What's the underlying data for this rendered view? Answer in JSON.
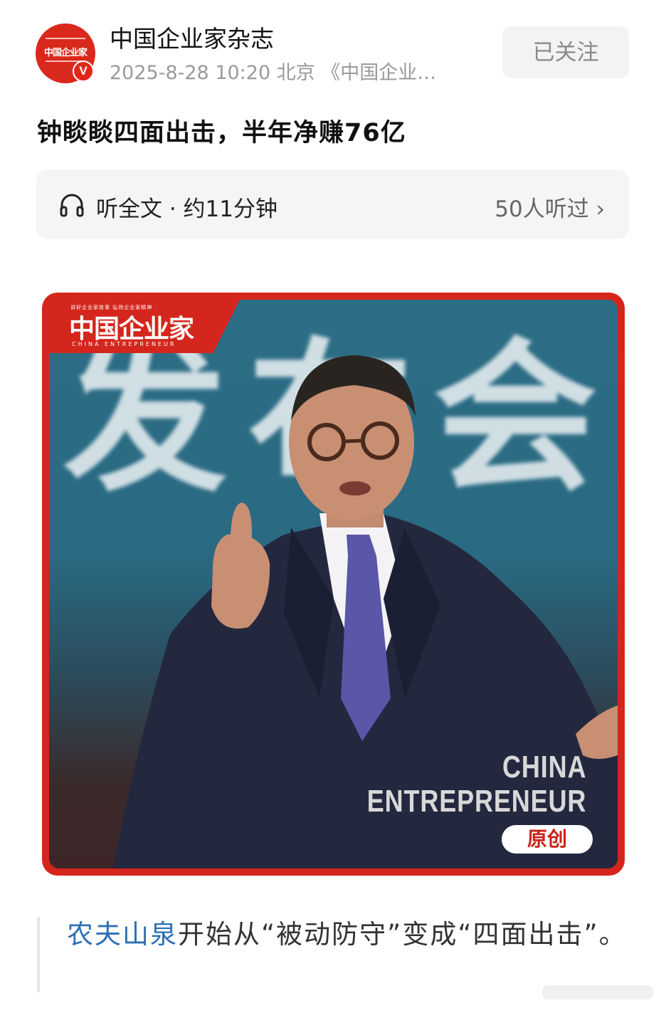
{
  "header": {
    "avatar_logo_text": "中国企业家",
    "verified_badge": "V",
    "account_name": "中国企业家杂志",
    "meta": "2025-8-28  10:20  北京  《中国企业…",
    "follow_label": "已关注"
  },
  "article": {
    "title": "钟睒睒四面出击，半年净赚76亿"
  },
  "listen": {
    "icon": "headphones-icon",
    "label": "听全文 · 约11分钟",
    "count": "50人听过 ›"
  },
  "image": {
    "magazine_tagline": "讲好企业家故事  弘扬企业家精神",
    "magazine_name": "中国企业家",
    "magazine_name_en": "CHINA ENTREPRENEUR",
    "background_chars": [
      "发",
      "布",
      "会"
    ],
    "caption_line1": "CHINA",
    "caption_line2": "ENTREPRENEUR",
    "badge": "原创"
  },
  "body": {
    "link_text": "农夫山泉",
    "text": "开始从“被动防守”变成“四面出击”。"
  },
  "colors": {
    "brand_red": "#d4261c",
    "link_blue": "#2d6fb5",
    "muted_gray": "#9a9a9a"
  }
}
